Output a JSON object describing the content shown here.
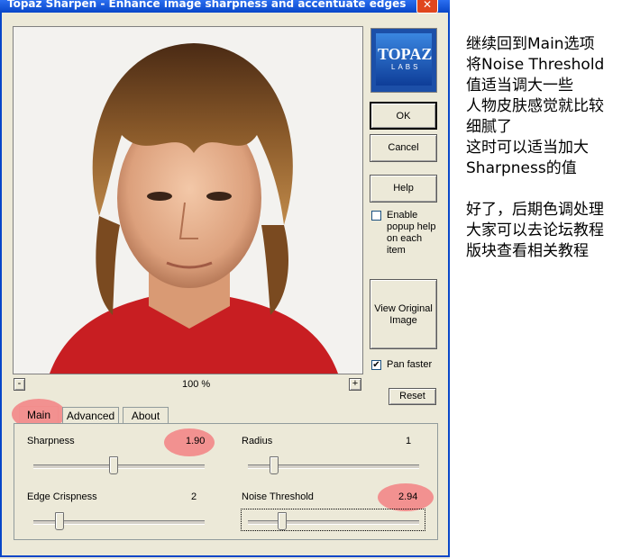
{
  "window": {
    "title": "Topaz Sharpen - Enhance image sharpness and accentuate edges",
    "close": "✕"
  },
  "logo": {
    "line1": "TOPAZ",
    "line2": "LABS"
  },
  "buttons": {
    "ok": "OK",
    "cancel": "Cancel",
    "help": "Help",
    "view_original": "View Original Image",
    "reset": "Reset"
  },
  "checks": {
    "popup_help": "Enable popup help on each item",
    "popup_help_checked": false,
    "pan_faster": "Pan faster",
    "pan_faster_checked": true
  },
  "zoom": {
    "minus": "-",
    "value": "100 %",
    "plus": "+"
  },
  "tabs": [
    "Main",
    "Advanced",
    "About"
  ],
  "sliders": [
    {
      "label": "Sharpness",
      "value": "1.90",
      "level": 0.47
    },
    {
      "label": "Radius",
      "value": "1",
      "level": 0.15
    },
    {
      "label": "Edge Crispness",
      "value": "2",
      "level": 0.15
    },
    {
      "label": "Noise Threshold",
      "value": "2.94",
      "level": 0.2
    }
  ],
  "annotation": {
    "lines": [
      "继续回到Main选项",
      "将Noise Threshold",
      "值适当调大一些",
      "人物皮肤感觉就比较",
      "细腻了",
      "这时可以适当加大",
      "Sharpness的值",
      "",
      "好了，后期色调处理",
      "大家可以去论坛教程",
      "版块查看相关教程"
    ]
  },
  "colors": {
    "highlight": "#f28c8c",
    "titlebar": "#0846c8",
    "face_bg": "#f3f2ef"
  }
}
